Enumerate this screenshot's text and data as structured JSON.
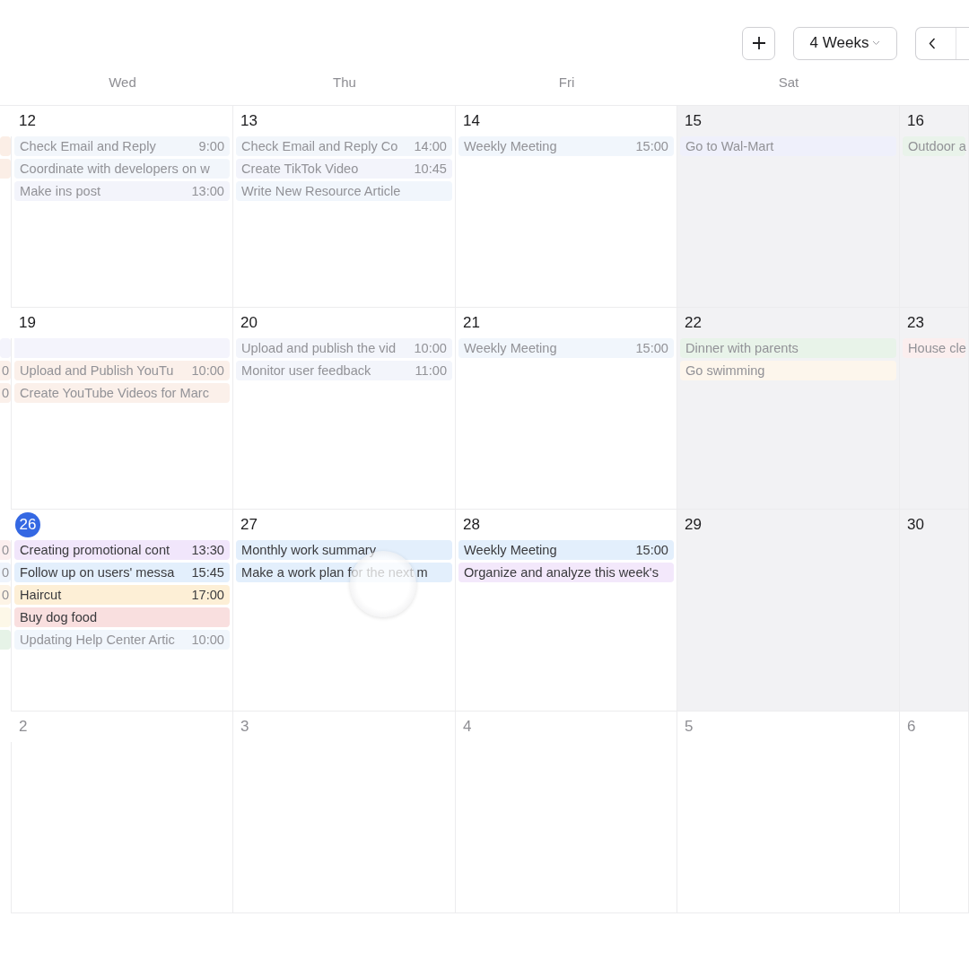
{
  "toolbar": {
    "view_select": {
      "label": "4 Weeks"
    }
  },
  "day_headers": [
    "Wed",
    "Thu",
    "Fri",
    "Sat"
  ],
  "weeks": [
    {
      "previous_day": {
        "weekend": false,
        "events": [
          {
            "kind": "bar",
            "color": "#fbeee6"
          },
          {
            "kind": "bar",
            "color": "#fbeee6"
          }
        ]
      },
      "days": [
        {
          "date": "12",
          "weekend": false,
          "today": false,
          "other_month": false,
          "events": [
            {
              "kind": "event",
              "title": "Check Email and Reply",
              "time": "9:00",
              "color": "#f2f6fb",
              "dimmed": true
            },
            {
              "kind": "event",
              "title": "Coordinate with developers on w",
              "color": "#f2f6fb",
              "dimmed": true
            },
            {
              "kind": "event",
              "title": "Make ins post",
              "time": "13:00",
              "color": "#f3f4fb",
              "dimmed": true
            }
          ]
        },
        {
          "date": "13",
          "weekend": false,
          "today": false,
          "other_month": false,
          "events": [
            {
              "kind": "event",
              "title": "Check Email and Reply Co",
              "time": "14:00",
              "color": "#f2f6fb",
              "dimmed": true
            },
            {
              "kind": "event",
              "title": "Create TikTok Video",
              "time": "10:45",
              "color": "#f3f4fb",
              "dimmed": true
            },
            {
              "kind": "event",
              "title": "Write New Resource Article",
              "color": "#f1f6fc",
              "dimmed": true
            }
          ]
        },
        {
          "date": "14",
          "weekend": false,
          "today": false,
          "other_month": false,
          "events": [
            {
              "kind": "event",
              "title": "Weekly Meeting",
              "time": "15:00",
              "color": "#f1f6fc",
              "dimmed": true
            }
          ]
        },
        {
          "date": "15",
          "weekend": true,
          "today": false,
          "other_month": false,
          "events": [
            {
              "kind": "event",
              "title": "Go to Wal-Mart",
              "color": "#eff0fb",
              "dimmed": true
            }
          ]
        },
        {
          "date": "16",
          "weekend": true,
          "today": false,
          "other_month": false,
          "events": [
            {
              "kind": "event",
              "title": "Outdoor a",
              "color": "#e9f3ea",
              "dimmed": true
            }
          ]
        }
      ]
    },
    {
      "previous_day": {
        "weekend": false,
        "events": [
          {
            "kind": "bar",
            "color": "#f4f4fc"
          },
          {
            "kind": "fragment",
            "time": "0",
            "color": "#fbf0ea",
            "dimmed": true
          },
          {
            "kind": "fragment",
            "time": "0",
            "color": "#fbf0ea",
            "dimmed": true
          }
        ]
      },
      "days": [
        {
          "date": "19",
          "weekend": false,
          "today": false,
          "other_month": false,
          "events": [
            {
              "kind": "bar",
              "color": "#f4f4fc"
            },
            {
              "kind": "event",
              "title": "Upload and Publish YouTu",
              "time": "10:00",
              "color": "#fbf0ea",
              "dimmed": true
            },
            {
              "kind": "event",
              "title": "Create YouTube Videos for Marc",
              "color": "#fbf0ea",
              "dimmed": true
            }
          ]
        },
        {
          "date": "20",
          "weekend": false,
          "today": false,
          "other_month": false,
          "events": [
            {
              "kind": "event",
              "title": "Upload and publish the vid",
              "time": "10:00",
              "color": "#f3f5fb",
              "dimmed": true
            },
            {
              "kind": "event",
              "title": "Monitor user feedback",
              "time": "11:00",
              "color": "#f3f5fb",
              "dimmed": true
            }
          ]
        },
        {
          "date": "21",
          "weekend": false,
          "today": false,
          "other_month": false,
          "events": [
            {
              "kind": "event",
              "title": "Weekly Meeting",
              "time": "15:00",
              "color": "#f1f6fc",
              "dimmed": true
            }
          ]
        },
        {
          "date": "22",
          "weekend": true,
          "today": false,
          "other_month": false,
          "events": [
            {
              "kind": "event",
              "title": "Dinner with parents",
              "color": "#e8f3e9",
              "dimmed": true
            },
            {
              "kind": "event",
              "title": "Go swimming",
              "color": "#fdf6ec",
              "dimmed": true
            }
          ]
        },
        {
          "date": "23",
          "weekend": true,
          "today": false,
          "other_month": false,
          "events": [
            {
              "kind": "event",
              "title": "House cle",
              "color": "#fbeeee",
              "dimmed": true
            }
          ]
        }
      ]
    },
    {
      "previous_day": {
        "weekend": false,
        "events": [
          {
            "kind": "fragment",
            "time": "0",
            "color": "#fbeeee",
            "dimmed": true
          },
          {
            "kind": "fragment",
            "time": "0",
            "color": "#eef4fc",
            "dimmed": true
          },
          {
            "kind": "fragment",
            "time": "0",
            "color": "#fdf4e6",
            "dimmed": true
          },
          {
            "kind": "bar",
            "color": "#fdf8e8"
          },
          {
            "kind": "bar",
            "color": "#e6f3e7"
          }
        ]
      },
      "days": [
        {
          "date": "26",
          "weekend": false,
          "today": true,
          "other_month": false,
          "events": [
            {
              "kind": "event",
              "title": "Creating promotional cont",
              "time": "13:30",
              "color": "#f1e6fb",
              "dimmed": false
            },
            {
              "kind": "event",
              "title": "Follow up on users' messa",
              "time": "15:45",
              "color": "#e3effc",
              "dimmed": false
            },
            {
              "kind": "event",
              "title": "Haircut",
              "time": "17:00",
              "color": "#fdefd6",
              "dimmed": false
            },
            {
              "kind": "event",
              "title": "Buy dog food",
              "color": "#f9dfdf",
              "dimmed": false
            },
            {
              "kind": "event",
              "title": "Updating Help Center Artic",
              "time": "10:00",
              "color": "#f1f6fc",
              "dimmed": true
            }
          ]
        },
        {
          "date": "27",
          "weekend": false,
          "today": false,
          "other_month": false,
          "events": [
            {
              "kind": "event",
              "title": "Monthly work summary",
              "color": "#e3effc",
              "dimmed": false
            },
            {
              "kind": "event",
              "title": "Make a work plan for the next m",
              "color": "#e3effc",
              "dimmed": false
            }
          ]
        },
        {
          "date": "28",
          "weekend": false,
          "today": false,
          "other_month": false,
          "events": [
            {
              "kind": "event",
              "title": "Weekly Meeting",
              "time": "15:00",
              "color": "#e3effc",
              "dimmed": false
            },
            {
              "kind": "event",
              "title": "Organize and analyze this week's",
              "color": "#f3e8fb",
              "dimmed": false
            }
          ]
        },
        {
          "date": "29",
          "weekend": true,
          "today": false,
          "other_month": false
        },
        {
          "date": "30",
          "weekend": true,
          "today": false,
          "other_month": false
        }
      ]
    },
    {
      "days": [
        {
          "date": "2",
          "today": false,
          "other_month": true
        },
        {
          "date": "3",
          "today": false,
          "other_month": true
        },
        {
          "date": "4",
          "today": false,
          "other_month": true
        },
        {
          "date": "5",
          "today": false,
          "other_month": true
        },
        {
          "date": "6",
          "today": false,
          "other_month": true
        }
      ]
    }
  ]
}
